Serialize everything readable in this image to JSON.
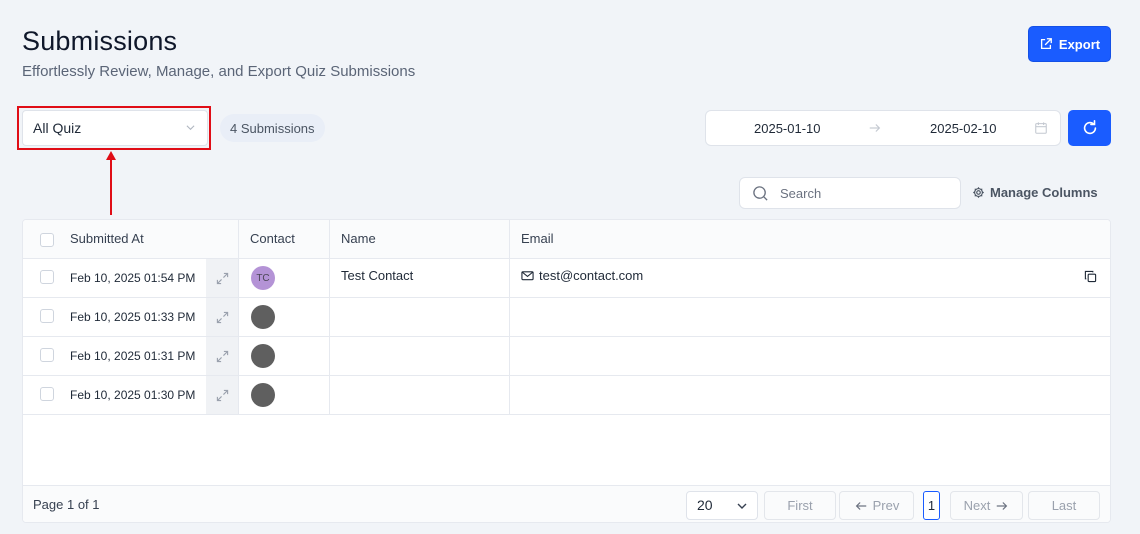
{
  "header": {
    "title": "Submissions",
    "subtitle": "Effortlessly Review, Manage, and Export Quiz Submissions",
    "export_label": "Export"
  },
  "filters": {
    "quiz_selected": "All Quiz",
    "submission_count": "4 Submissions",
    "date_start": "2025-01-10",
    "date_end": "2025-02-10"
  },
  "toolbar": {
    "search_placeholder": "Search",
    "manage_columns_label": "Manage Columns"
  },
  "table": {
    "columns": [
      "Submitted At",
      "Contact",
      "Name",
      "Email"
    ],
    "rows": [
      {
        "submitted_at": "Feb 10, 2025  01:54 PM",
        "contact_initials": "TC",
        "name": "Test Contact",
        "email": "test@contact.com"
      },
      {
        "submitted_at": "Feb 10, 2025  01:33 PM",
        "contact_initials": "",
        "name": "",
        "email": ""
      },
      {
        "submitted_at": "Feb 10, 2025  01:31 PM",
        "contact_initials": "",
        "name": "",
        "email": ""
      },
      {
        "submitted_at": "Feb 10, 2025  01:30 PM",
        "contact_initials": "",
        "name": "",
        "email": ""
      }
    ]
  },
  "pagination": {
    "page_info": "Page 1 of 1",
    "per_page": "20",
    "first_label": "First",
    "prev_label": "Prev",
    "current_page": "1",
    "next_label": "Next",
    "last_label": "Last"
  },
  "colors": {
    "primary": "#1a5cff",
    "highlight": "#e00d16",
    "avatar_tc": "#b493d6",
    "avatar_default": "#5f5f5f"
  },
  "icons": {
    "export": "export-icon",
    "refresh": "refresh-icon",
    "search": "search-icon",
    "gear": "gear-icon",
    "calendar": "calendar-icon",
    "expand": "expand-icon",
    "mail": "mail-icon",
    "copy": "copy-icon"
  }
}
